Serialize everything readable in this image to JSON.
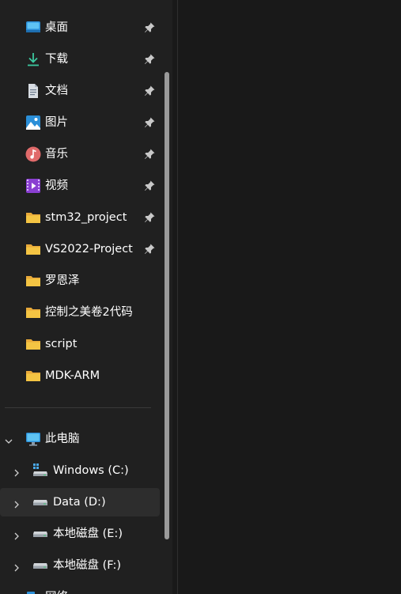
{
  "quick_access": [
    {
      "label": "桌面",
      "icon": "desktop-icon",
      "pinned": true
    },
    {
      "label": "下载",
      "icon": "download-icon",
      "pinned": true
    },
    {
      "label": "文档",
      "icon": "document-icon",
      "pinned": true
    },
    {
      "label": "图片",
      "icon": "pictures-icon",
      "pinned": true
    },
    {
      "label": "音乐",
      "icon": "music-icon",
      "pinned": true
    },
    {
      "label": "视频",
      "icon": "video-icon",
      "pinned": true
    },
    {
      "label": "stm32_project",
      "icon": "folder-icon",
      "pinned": true
    },
    {
      "label": "VS2022-Project",
      "icon": "folder-icon",
      "pinned": true
    },
    {
      "label": "罗恩泽",
      "icon": "folder-icon",
      "pinned": false
    },
    {
      "label": "控制之美卷2代码",
      "icon": "folder-icon",
      "pinned": false
    },
    {
      "label": "script",
      "icon": "folder-icon",
      "pinned": false
    },
    {
      "label": "MDK-ARM",
      "icon": "folder-icon",
      "pinned": false
    }
  ],
  "this_pc": {
    "label": "此电脑",
    "expanded": true,
    "drives": [
      {
        "label": "Windows (C:)",
        "icon": "system-drive-icon",
        "selected": false
      },
      {
        "label": "Data (D:)",
        "icon": "drive-icon",
        "selected": true
      },
      {
        "label": "本地磁盘 (E:)",
        "icon": "drive-icon",
        "selected": false
      },
      {
        "label": "本地磁盘 (F:)",
        "icon": "drive-icon",
        "selected": false
      }
    ]
  },
  "network": {
    "label": "网络",
    "icon": "network-icon"
  },
  "colors": {
    "background": "#191919",
    "nav_background": "#202020",
    "selected_row": "#2d2d2d",
    "folder": "#f4c443",
    "accent": "#2b8fd8"
  }
}
